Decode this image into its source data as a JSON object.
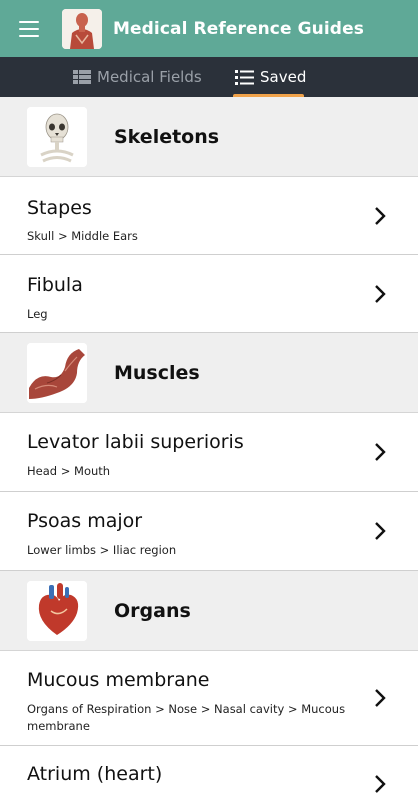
{
  "appbar": {
    "title": "Medical Reference Guides"
  },
  "tabs": [
    {
      "label": "Medical Fields"
    },
    {
      "label": "Saved"
    }
  ],
  "sections": [
    {
      "title": "Skeletons",
      "items": [
        {
          "name": "Stapes",
          "path": "Skull > Middle Ears"
        },
        {
          "name": "Fibula",
          "path": "Leg"
        }
      ]
    },
    {
      "title": "Muscles",
      "items": [
        {
          "name": "Levator labii superioris",
          "path": "Head > Mouth"
        },
        {
          "name": "Psoas major",
          "path": "Lower limbs > Iliac region"
        }
      ]
    },
    {
      "title": "Organs",
      "items": [
        {
          "name": "Mucous membrane",
          "path": "Organs of Respiration > Nose > Nasal cavity > Mucous membrane"
        },
        {
          "name": "Atrium (heart)",
          "path": ""
        }
      ]
    }
  ],
  "colors": {
    "appbar": "#5fa997",
    "tabbar": "#2b313a",
    "indicator": "#f0a24a"
  },
  "icons": {
    "menu": "hamburger-icon",
    "fields_tab": "grid-list-icon",
    "saved_tab": "list-icon",
    "row": "chevron-right-icon"
  }
}
